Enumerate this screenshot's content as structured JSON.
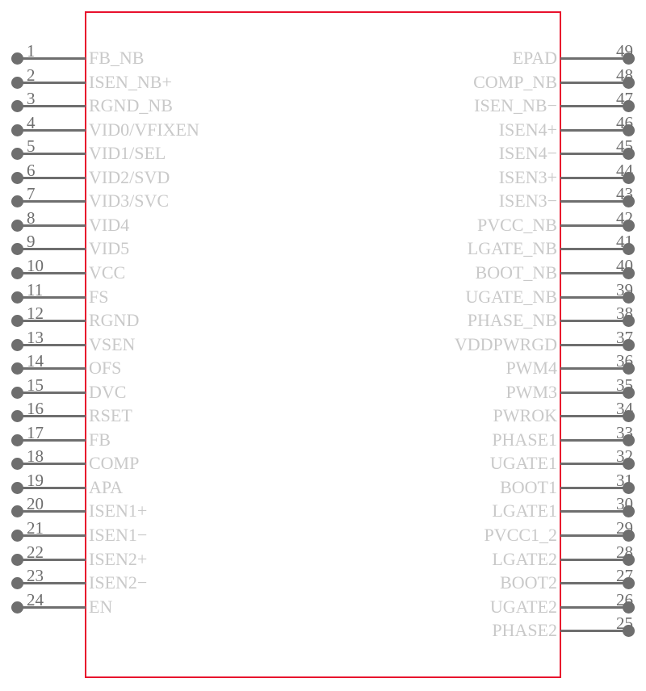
{
  "diagram": {
    "type": "ic-pinout",
    "package_outline_color": "#e8112d",
    "pin_color": "#6e6e6e",
    "label_color": "#c9c9c9",
    "background_color": "#ffffff",
    "total_pins": 49,
    "left_pins": [
      {
        "number": "1",
        "label": "FB_NB"
      },
      {
        "number": "2",
        "label": "ISEN_NB+"
      },
      {
        "number": "3",
        "label": "RGND_NB"
      },
      {
        "number": "4",
        "label": "VID0/VFIXEN"
      },
      {
        "number": "5",
        "label": "VID1/SEL"
      },
      {
        "number": "6",
        "label": "VID2/SVD"
      },
      {
        "number": "7",
        "label": "VID3/SVC"
      },
      {
        "number": "8",
        "label": "VID4"
      },
      {
        "number": "9",
        "label": "VID5"
      },
      {
        "number": "10",
        "label": "VCC"
      },
      {
        "number": "11",
        "label": "FS"
      },
      {
        "number": "12",
        "label": "RGND"
      },
      {
        "number": "13",
        "label": "VSEN"
      },
      {
        "number": "14",
        "label": "OFS"
      },
      {
        "number": "15",
        "label": "DVC"
      },
      {
        "number": "16",
        "label": "RSET"
      },
      {
        "number": "17",
        "label": "FB"
      },
      {
        "number": "18",
        "label": "COMP"
      },
      {
        "number": "19",
        "label": "APA"
      },
      {
        "number": "20",
        "label": "ISEN1+"
      },
      {
        "number": "21",
        "label": "ISEN1−"
      },
      {
        "number": "22",
        "label": "ISEN2+"
      },
      {
        "number": "23",
        "label": "ISEN2−"
      },
      {
        "number": "24",
        "label": "EN"
      }
    ],
    "right_pins": [
      {
        "number": "49",
        "label": "EPAD"
      },
      {
        "number": "48",
        "label": "COMP_NB"
      },
      {
        "number": "47",
        "label": "ISEN_NB−"
      },
      {
        "number": "46",
        "label": "ISEN4+"
      },
      {
        "number": "45",
        "label": "ISEN4−"
      },
      {
        "number": "44",
        "label": "ISEN3+"
      },
      {
        "number": "43",
        "label": "ISEN3−"
      },
      {
        "number": "42",
        "label": "PVCC_NB"
      },
      {
        "number": "41",
        "label": "LGATE_NB"
      },
      {
        "number": "40",
        "label": "BOOT_NB"
      },
      {
        "number": "39",
        "label": "UGATE_NB"
      },
      {
        "number": "38",
        "label": "PHASE_NB"
      },
      {
        "number": "37",
        "label": "VDDPWRGD"
      },
      {
        "number": "36",
        "label": "PWM4"
      },
      {
        "number": "35",
        "label": "PWM3"
      },
      {
        "number": "34",
        "label": "PWROK"
      },
      {
        "number": "33",
        "label": "PHASE1"
      },
      {
        "number": "32",
        "label": "UGATE1"
      },
      {
        "number": "31",
        "label": "BOOT1"
      },
      {
        "number": "30",
        "label": "LGATE1"
      },
      {
        "number": "29",
        "label": "PVCC1_2"
      },
      {
        "number": "28",
        "label": "LGATE2"
      },
      {
        "number": "27",
        "label": "BOOT2"
      },
      {
        "number": "26",
        "label": "UGATE2"
      },
      {
        "number": "25",
        "label": "PHASE2"
      }
    ]
  }
}
